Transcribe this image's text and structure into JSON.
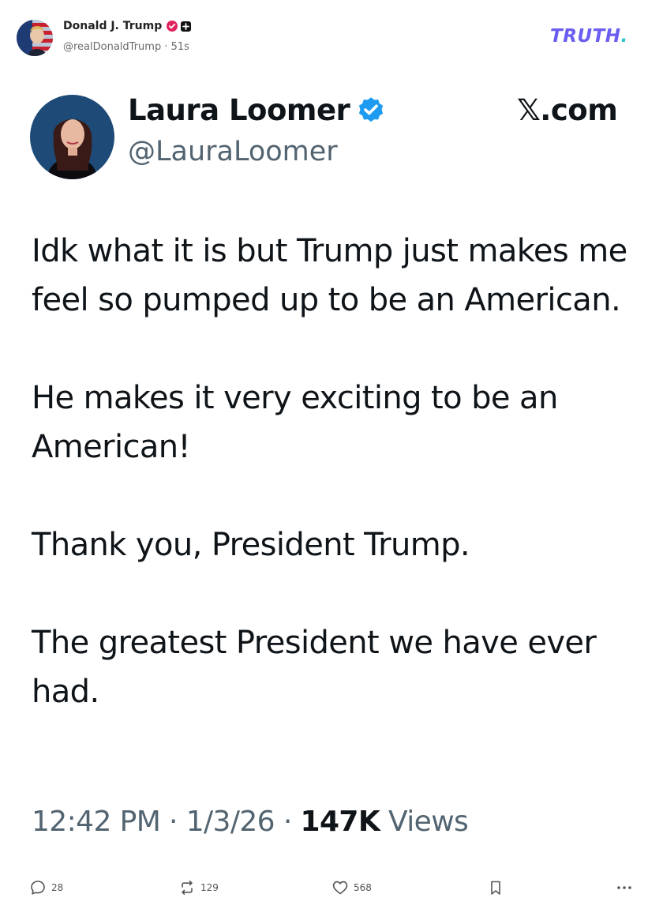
{
  "truth_post": {
    "author_name": "Donald J. Trump",
    "author_handle": "@realDonaldTrump",
    "separator": "·",
    "time_ago": "51s",
    "logo_text": "TRUTH",
    "logo_dot": "."
  },
  "embedded_post": {
    "name": "Laura Loomer",
    "handle": "@LauraLoomer",
    "brand": "𝕏.com",
    "paragraphs": [
      "Idk what it is but Trump just makes me feel so pumped up to be an American.",
      "He makes it very exciting to be an American!",
      "Thank you, President Trump.",
      "The greatest President we have ever had."
    ],
    "time": "12:42 PM",
    "date": "1/3/26",
    "views_count": "147K",
    "views_label": "Views",
    "meta_sep": " · "
  },
  "actions": {
    "replies": "28",
    "retruths": "129",
    "likes": "568"
  },
  "colors": {
    "truth_brand": "#6a5df0",
    "verified_blue": "#1d9bf0",
    "truth_verified": "#e0245e"
  }
}
